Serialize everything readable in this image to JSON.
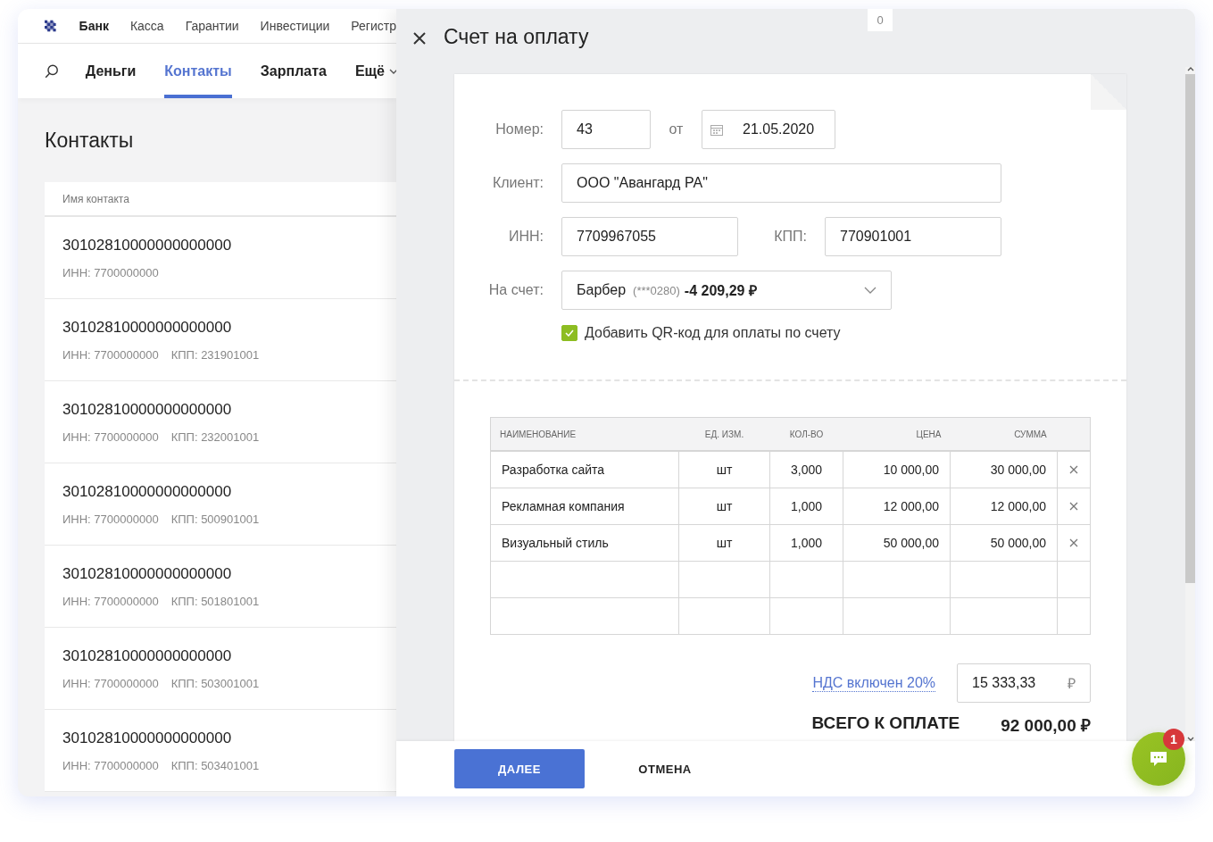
{
  "top_nav": [
    {
      "label": "Банк",
      "selected": true
    },
    {
      "label": "Касса",
      "selected": false
    },
    {
      "label": "Гарантии",
      "selected": false
    },
    {
      "label": "Инвестиции",
      "selected": false
    },
    {
      "label": "Регистр",
      "selected": false
    }
  ],
  "section_nav": [
    {
      "label": "Деньги",
      "selected": false,
      "dropdown": false
    },
    {
      "label": "Контакты",
      "selected": true,
      "dropdown": false
    },
    {
      "label": "Зарплата",
      "selected": false,
      "dropdown": false
    },
    {
      "label": "Ещё",
      "selected": false,
      "dropdown": true
    }
  ],
  "contacts": {
    "title": "Контакты",
    "column": "Имя контакта",
    "rows": [
      {
        "name": "30102810000000000000",
        "inn": "ИНН: 7700000000"
      },
      {
        "name": "30102810000000000000",
        "inn": "ИНН: 7700000000",
        "kpp": "КПП: 231901001"
      },
      {
        "name": "30102810000000000000",
        "inn": "ИНН: 7700000000",
        "kpp": "КПП: 232001001"
      },
      {
        "name": "30102810000000000000",
        "inn": "ИНН: 7700000000",
        "kpp": "КПП: 500901001"
      },
      {
        "name": "30102810000000000000",
        "inn": "ИНН: 7700000000",
        "kpp": "КПП: 501801001"
      },
      {
        "name": "30102810000000000000",
        "inn": "ИНН: 7700000000",
        "kpp": "КПП: 503001001"
      },
      {
        "name": "30102810000000000000",
        "inn": "ИНН: 7700000000",
        "kpp": "КПП: 503401001"
      }
    ]
  },
  "drawer": {
    "title": "Счет на оплату",
    "counter": "0",
    "form": {
      "number_label": "Номер:",
      "number": "43",
      "date_label": "от",
      "date": "21.05.2020",
      "client_label": "Клиент:",
      "client": "ООО \"Авангард РА\"",
      "inn_label": "ИНН:",
      "inn": "7709967055",
      "kpp_label": "КПП:",
      "kpp": "770901001",
      "account_label": "На счет:",
      "account": {
        "name": "Барбер",
        "number": "(***0280)",
        "balance": "-4 209,29 ₽"
      },
      "qr": {
        "label": "Добавить QR-код для оплаты по счету",
        "checked": true
      }
    },
    "table": {
      "columns": [
        "НАИМЕНОВАНИЕ",
        "ЕД. ИЗМ.",
        "КОЛ-ВО",
        "ЦЕНА",
        "СУММА"
      ],
      "rows": [
        [
          "Разработка сайта",
          "шт",
          "3,000",
          "10 000,00",
          "30 000,00"
        ],
        [
          "Рекламная компания",
          "шт",
          "1,000",
          "12 000,00",
          "12 000,00"
        ],
        [
          "Визуальный стиль",
          "шт",
          "1,000",
          "50 000,00",
          "50 000,00"
        ]
      ]
    },
    "vat_link": "НДС включен 20%",
    "vat": "15 333,33",
    "currency": "₽",
    "total_label": "ВСЕГО К ОПЛАТЕ",
    "total": "92 000,00 ₽",
    "buttons": [
      {
        "label": "ДАЛЕЕ",
        "kind": "primary"
      },
      {
        "label": "ОТМЕНА",
        "kind": "flat"
      }
    ]
  },
  "chat": {
    "badge": "1"
  }
}
